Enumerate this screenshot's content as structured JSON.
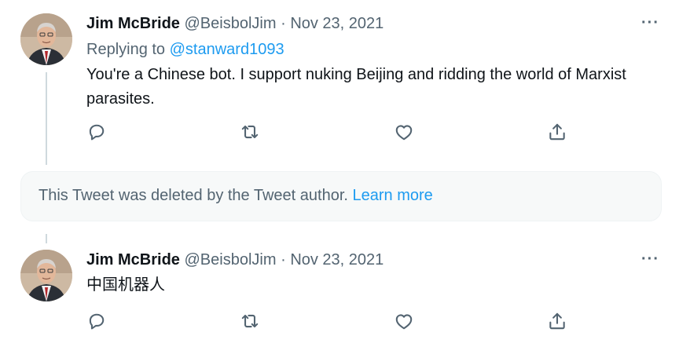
{
  "tweets": [
    {
      "author_name": "Jim McBride",
      "handle": "@BeisbolJim",
      "separator": "·",
      "date": "Nov 23, 2021",
      "more": "···",
      "replying_prefix": "Replying to",
      "replying_handle": "@stanward1093",
      "text": "You're a Chinese bot.  I support nuking Beijing and ridding the world of Marxist parasites."
    },
    {
      "author_name": "Jim McBride",
      "handle": "@BeisbolJim",
      "separator": "·",
      "date": "Nov 23, 2021",
      "more": "···",
      "text": "中国机器人"
    }
  ],
  "deleted_notice": {
    "text": "This Tweet was deleted by the Tweet author.",
    "link": "Learn more"
  },
  "icons": [
    "reply-icon",
    "retweet-icon",
    "like-icon",
    "share-icon",
    "more-icon"
  ],
  "colors": {
    "link": "#1d9bf0",
    "secondary_text": "#536471",
    "thread_line": "#cfd9de",
    "notice_background": "#f7f9f9"
  }
}
